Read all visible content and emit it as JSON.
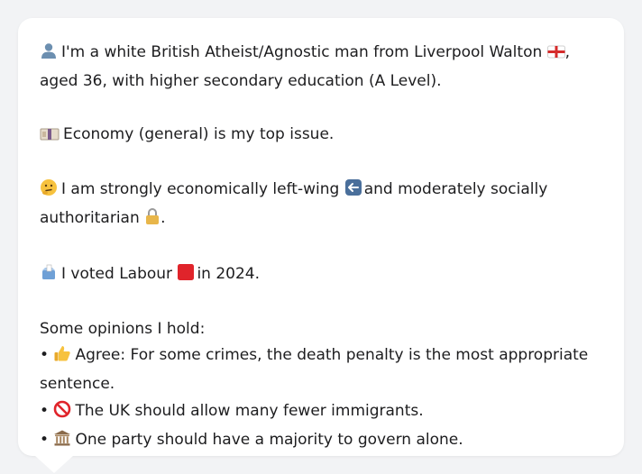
{
  "profile": {
    "intro_before_flag": "I'm a white British Atheist/Agnostic man from Liverpool Walton",
    "intro_after_flag": ", aged 36, with higher secondary education (A Level).",
    "top_issue": "Economy (general) is my top issue.",
    "political_before_left": "I am strongly economically left-wing",
    "political_middle": "and moderately socially authoritarian",
    "political_end": ".",
    "vote_before": "I voted Labour",
    "vote_after": "in 2024."
  },
  "opinions": {
    "heading": "Some opinions I hold:",
    "bullet": "•",
    "items": [
      {
        "icon": "thumbs-up-icon",
        "text": "Agree: For some crimes, the death penalty is the most appropriate sentence."
      },
      {
        "icon": "prohibited-icon",
        "text": "The UK should allow many fewer immigrants."
      },
      {
        "icon": "classical-building-icon",
        "text": "One party should have a majority to govern alone."
      }
    ]
  },
  "colors": {
    "background": "#f2f3f5",
    "bubble": "#ffffff",
    "text": "#1d1d1f",
    "labour_red": "#e0242b"
  }
}
